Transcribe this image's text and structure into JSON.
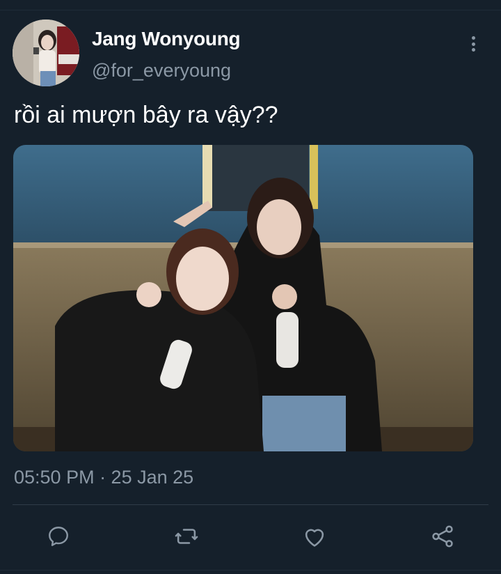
{
  "tweet": {
    "author": {
      "display_name": "Jang Wonyoung",
      "handle": "@for_everyoung"
    },
    "text": "rồi ai mượn bây ra vậy??",
    "timestamp": "05:50 PM · 25 Jan 25"
  },
  "actions": [
    {
      "icon": "reply-icon"
    },
    {
      "icon": "retweet-icon"
    },
    {
      "icon": "like-icon"
    },
    {
      "icon": "share-icon"
    }
  ],
  "colors": {
    "background": "#15202b",
    "text_primary": "#ffffff",
    "text_secondary": "#8b98a5",
    "divider": "#2f3b48"
  }
}
